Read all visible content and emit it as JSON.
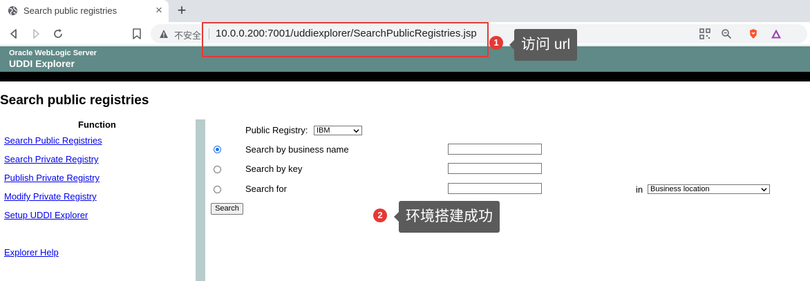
{
  "browser": {
    "tab_title": "Search public registries",
    "security_label": "不安全",
    "url": "10.0.0.200:7001/uddiexplorer/SearchPublicRegistries.jsp"
  },
  "header": {
    "product": "Oracle WebLogic Server",
    "app": "UDDI Explorer"
  },
  "page": {
    "title": "Search public registries"
  },
  "sidebar": {
    "heading": "Function",
    "items": [
      {
        "label": "Search Public Registries"
      },
      {
        "label": "Search Private Registry"
      },
      {
        "label": "Publish Private Registry"
      },
      {
        "label": "Modify Private Registry"
      },
      {
        "label": "Setup UDDI Explorer"
      },
      {
        "label": "Explorer Help"
      }
    ]
  },
  "form": {
    "registry_label": "Public Registry:",
    "registry_value": "IBM",
    "options": [
      {
        "label": "Search by business name",
        "checked": true,
        "value": ""
      },
      {
        "label": "Search by key",
        "checked": false,
        "value": ""
      },
      {
        "label": "Search for",
        "checked": false,
        "value": ""
      }
    ],
    "in_label": "in",
    "in_value": "Business location",
    "search_button": "Search"
  },
  "annotations": [
    {
      "number": "1",
      "text": "访问 url"
    },
    {
      "number": "2",
      "text": "环境搭建成功"
    }
  ],
  "colors": {
    "header_bg": "#5f8a87",
    "annotation_red": "#e53935",
    "callout_bg": "#5b5b5b",
    "link": "#0000ee"
  }
}
